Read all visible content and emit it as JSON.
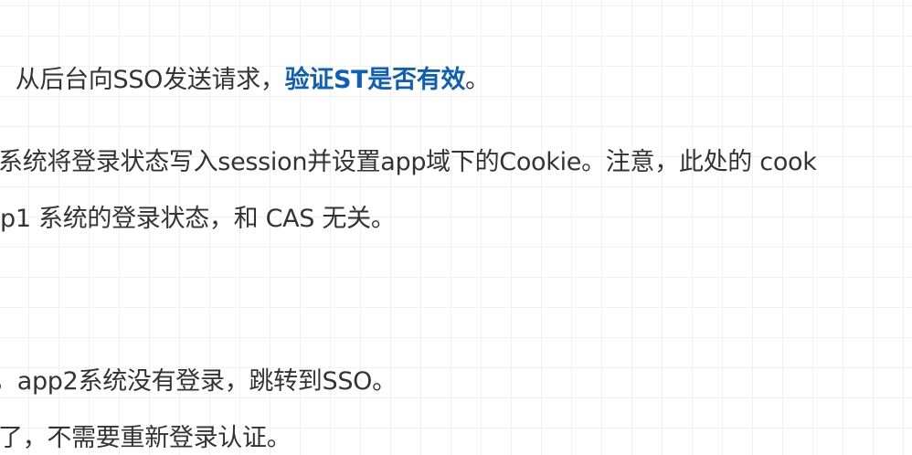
{
  "paragraphs": {
    "p1": {
      "text": "，从后台向SSO发送请求，",
      "emphasis": "验证ST是否有效",
      "end": "。"
    },
    "p2": {
      "line1": "系统将登录状态写入session并设置app域下的Cookie。注意，此处的 cook",
      "line2": "p1 系统的登录状态，和 CAS 无关。"
    },
    "p3": {
      "line1": "，app2系统没有登录，跳转到SSO。",
      "line2": "了，不需要重新登录认证。"
    }
  },
  "colors": {
    "text": "#333333",
    "emphasis": "#0f5fb8",
    "grid": "#f1f1f1"
  }
}
